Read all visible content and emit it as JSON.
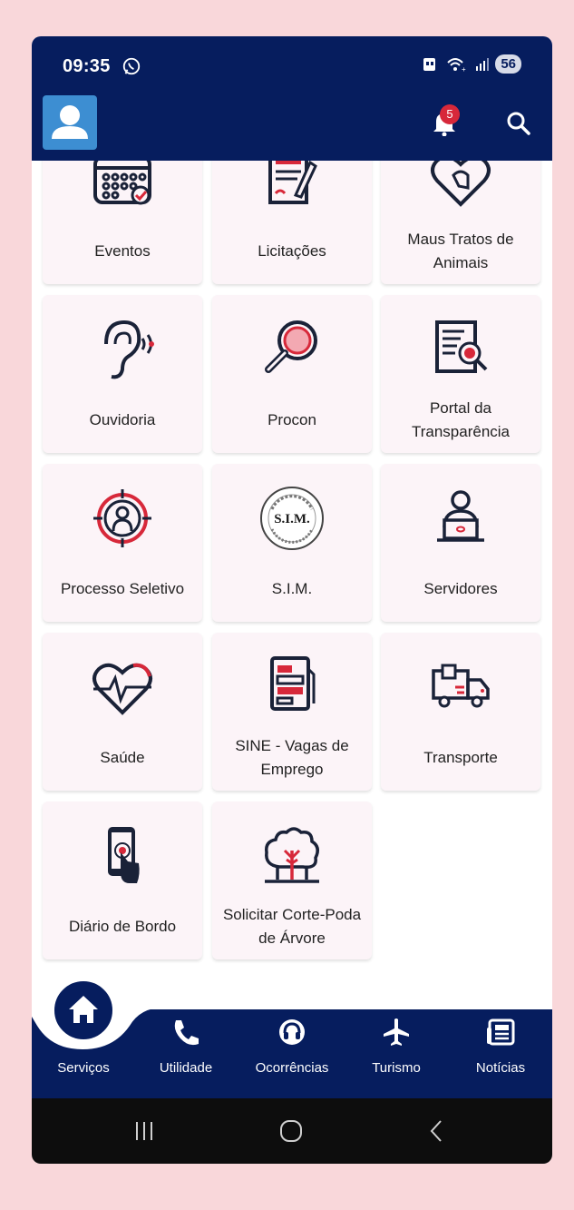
{
  "status": {
    "time": "09:35",
    "battery": "56"
  },
  "header": {
    "notification_count": "5"
  },
  "services": [
    {
      "label": "Eventos",
      "icon": "calendar-icon"
    },
    {
      "label": "Licitações",
      "icon": "document-pen-icon"
    },
    {
      "label": "Maus Tratos de Animais",
      "icon": "pet-heart-icon"
    },
    {
      "label": "Ouvidoria",
      "icon": "ear-icon"
    },
    {
      "label": "Procon",
      "icon": "magnifier-icon"
    },
    {
      "label": "Portal da Transparência",
      "icon": "document-search-icon"
    },
    {
      "label": "Processo Seletivo",
      "icon": "target-person-icon"
    },
    {
      "label": "S.I.M.",
      "icon": "sim-seal-icon",
      "seal_text": "S.I.M."
    },
    {
      "label": "Servidores",
      "icon": "person-laptop-icon"
    },
    {
      "label": "Saúde",
      "icon": "heart-pulse-icon"
    },
    {
      "label": "SINE - Vagas de Emprego",
      "icon": "job-papers-icon"
    },
    {
      "label": "Transporte",
      "icon": "truck-icon"
    },
    {
      "label": "Diário de Bordo",
      "icon": "phone-touch-icon"
    },
    {
      "label": "Solicitar Corte-Poda de Árvore",
      "icon": "tree-icon"
    }
  ],
  "bottom_nav": [
    {
      "label": "Serviços",
      "icon": "home-icon"
    },
    {
      "label": "Utilidade",
      "icon": "phone-icon"
    },
    {
      "label": "Ocorrências",
      "icon": "headset-icon"
    },
    {
      "label": "Turismo",
      "icon": "airplane-icon"
    },
    {
      "label": "Notícias",
      "icon": "newspaper-icon"
    }
  ],
  "colors": {
    "primary": "#061d5e",
    "accent": "#d7283a",
    "card": "#fcf4f8",
    "background": "#f9d7da"
  }
}
